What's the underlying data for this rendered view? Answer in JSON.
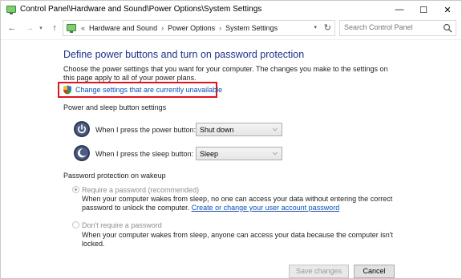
{
  "window": {
    "title": "Control Panel\\Hardware and Sound\\Power Options\\System Settings",
    "controls": {
      "minimize": "—",
      "maximize": "☐",
      "close": "✕"
    }
  },
  "address_bar": {
    "prefix": "«",
    "crumbs": [
      "Hardware and Sound",
      "Power Options",
      "System Settings"
    ],
    "separator": "›"
  },
  "search": {
    "placeholder": "Search Control Panel"
  },
  "page": {
    "heading": "Define power buttons and turn on password protection",
    "description": "Choose the power settings that you want for your computer. The changes you make to the settings on this page apply to all of your power plans.",
    "change_link": "Change settings that are currently unavailable"
  },
  "power_settings": {
    "section_label": "Power and sleep button settings",
    "power_button": {
      "label": "When I press the power button:",
      "value": "Shut down"
    },
    "sleep_button": {
      "label": "When I press the sleep button:",
      "value": "Sleep"
    }
  },
  "password_settings": {
    "section_label": "Password protection on wakeup",
    "require": {
      "label": "Require a password (recommended)",
      "description": "When your computer wakes from sleep, no one can access your data without entering the correct password to unlock the computer.",
      "link": "Create or change your user account password",
      "selected": true
    },
    "no_require": {
      "label": "Don't require a password",
      "description": "When your computer wakes from sleep, anyone can access your data because the computer isn't locked.",
      "selected": false
    }
  },
  "footer": {
    "save_label": "Save changes",
    "cancel_label": "Cancel"
  },
  "colors": {
    "heading": "#1e3287",
    "link": "#0b4fb6",
    "highlight_border": "#e0141e"
  }
}
